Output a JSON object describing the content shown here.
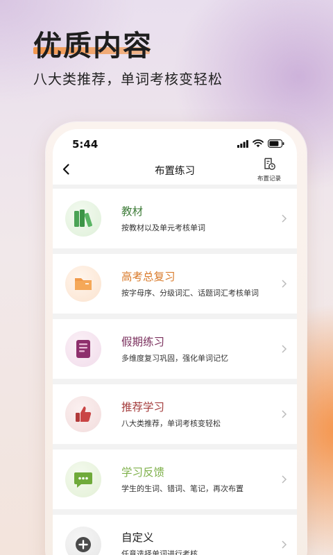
{
  "hero": {
    "title": "优质内容",
    "subtitle": "八大类推荐，单词考核变轻松"
  },
  "status_bar": {
    "time": "5:44"
  },
  "nav": {
    "title": "布置练习",
    "record_label": "布置记录"
  },
  "cards": [
    {
      "title": "教材",
      "desc": "按教材以及单元考核单词",
      "title_color": "#3f7d3a",
      "icon": "books-icon"
    },
    {
      "title": "高考总复习",
      "desc": "按字母序、分级词汇、话题词汇考核单词",
      "title_color": "#d97a2a",
      "icon": "folder-icon"
    },
    {
      "title": "假期练习",
      "desc": "多维度复习巩固，强化单词记忆",
      "title_color": "#7a2f5c",
      "icon": "list-card-icon"
    },
    {
      "title": "推荐学习",
      "desc": "八大类推荐，单词考核变轻松",
      "title_color": "#a33a3a",
      "icon": "thumbs-up-icon"
    },
    {
      "title": "学习反馈",
      "desc": "学生的生词、错词、笔记，再次布置",
      "title_color": "#7eb04a",
      "icon": "chat-bubble-icon"
    },
    {
      "title": "自定义",
      "desc": "任意选择单词进行考核",
      "title_color": "#222222",
      "icon": "plus-circle-icon"
    }
  ]
}
